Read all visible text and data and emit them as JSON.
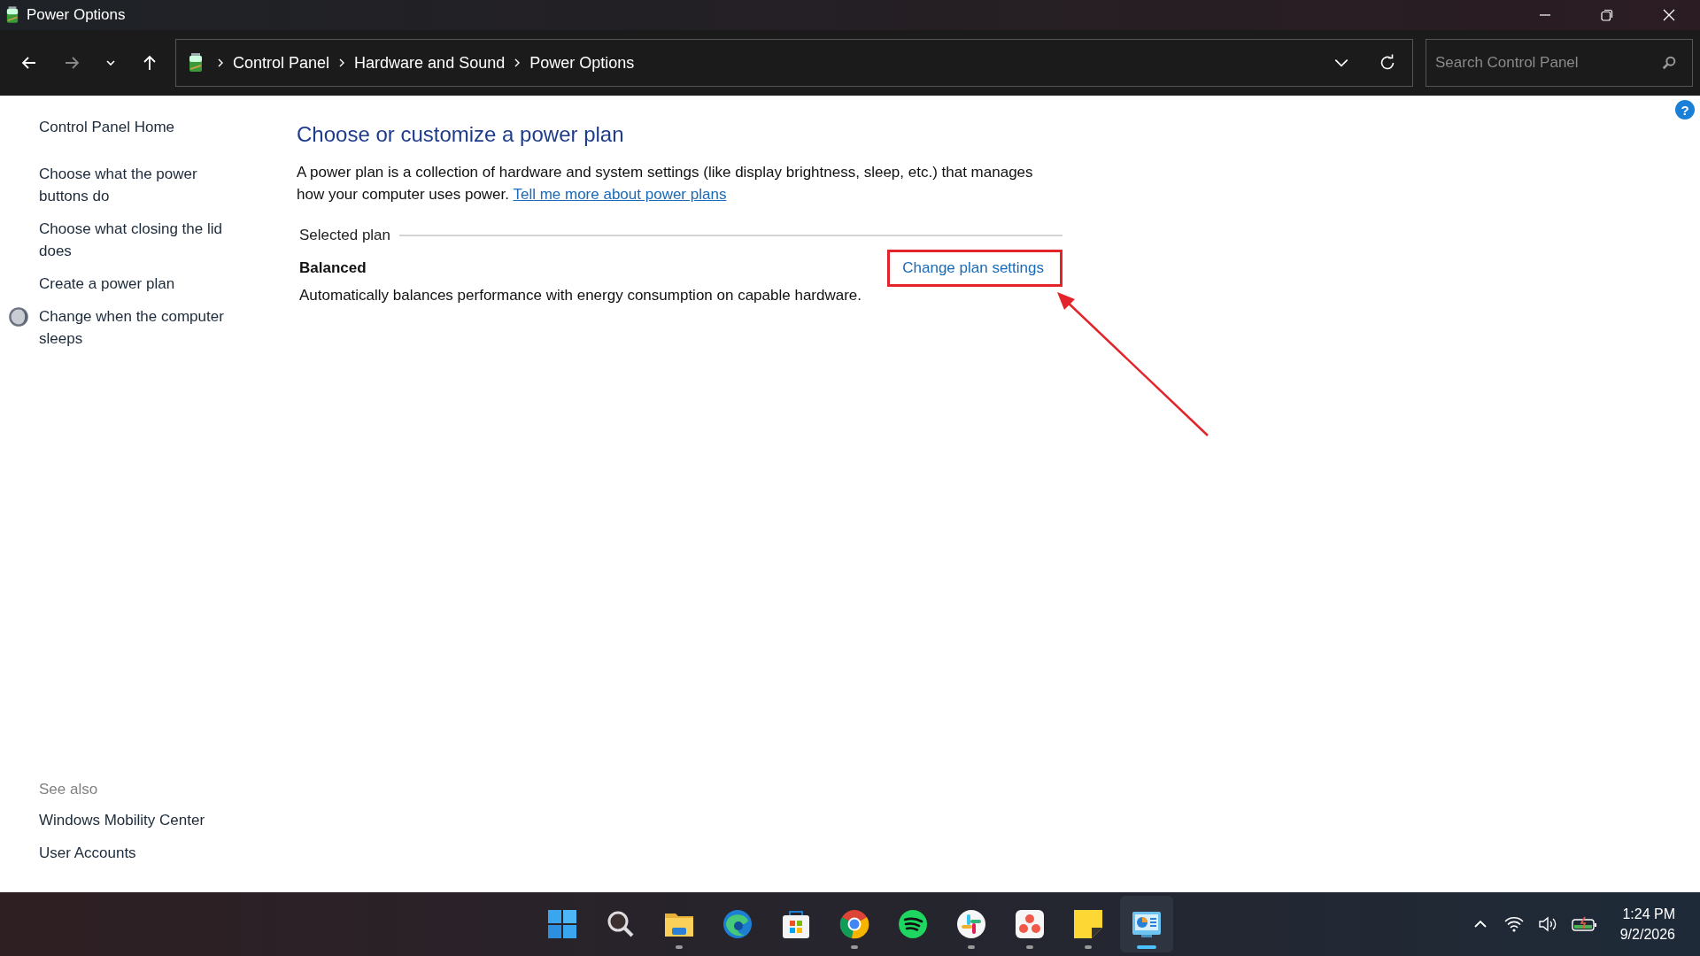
{
  "window": {
    "title": "Power Options"
  },
  "nav": {
    "breadcrumb": [
      "Control Panel",
      "Hardware and Sound",
      "Power Options"
    ],
    "search": {
      "placeholder": "Search Control Panel"
    }
  },
  "help": "?",
  "sidebar": {
    "items": [
      {
        "label": "Control Panel Home",
        "has_icon": false
      },
      {
        "label": "Choose what the power buttons do",
        "has_icon": false
      },
      {
        "label": "Choose what closing the lid does",
        "has_icon": false
      },
      {
        "label": "Create a power plan",
        "has_icon": false
      },
      {
        "label": "Change when the computer sleeps",
        "has_icon": true
      }
    ],
    "see_also": {
      "title": "See also",
      "links": [
        "Windows Mobility Center",
        "User Accounts"
      ]
    }
  },
  "main": {
    "heading": "Choose or customize a power plan",
    "intro": "A power plan is a collection of hardware and system settings (like display brightness, sleep, etc.) that manages how your computer uses power.",
    "intro_link": "Tell me more about power plans",
    "section_title": "Selected plan",
    "plan": {
      "name": "Balanced",
      "description": "Automatically balances performance with energy consumption on capable hardware.",
      "action": "Change plan settings",
      "highlighted": true
    }
  },
  "taskbar": {
    "apps": [
      {
        "kind": "start",
        "running": false,
        "selected": false
      },
      {
        "kind": "search",
        "running": false,
        "selected": false
      },
      {
        "kind": "folder",
        "running": true,
        "selected": false
      },
      {
        "kind": "wave",
        "running": false,
        "selected": false
      },
      {
        "kind": "bag",
        "running": false,
        "selected": false
      },
      {
        "kind": "ring",
        "running": true,
        "selected": false
      },
      {
        "kind": "music",
        "running": false,
        "selected": false
      },
      {
        "kind": "hash",
        "running": true,
        "selected": false
      },
      {
        "kind": "dots",
        "running": true,
        "selected": false
      },
      {
        "kind": "note",
        "running": true,
        "selected": false
      },
      {
        "kind": "panel",
        "running": true,
        "selected": true
      }
    ],
    "time": "1:24 PM",
    "date": "9/2/2026"
  }
}
